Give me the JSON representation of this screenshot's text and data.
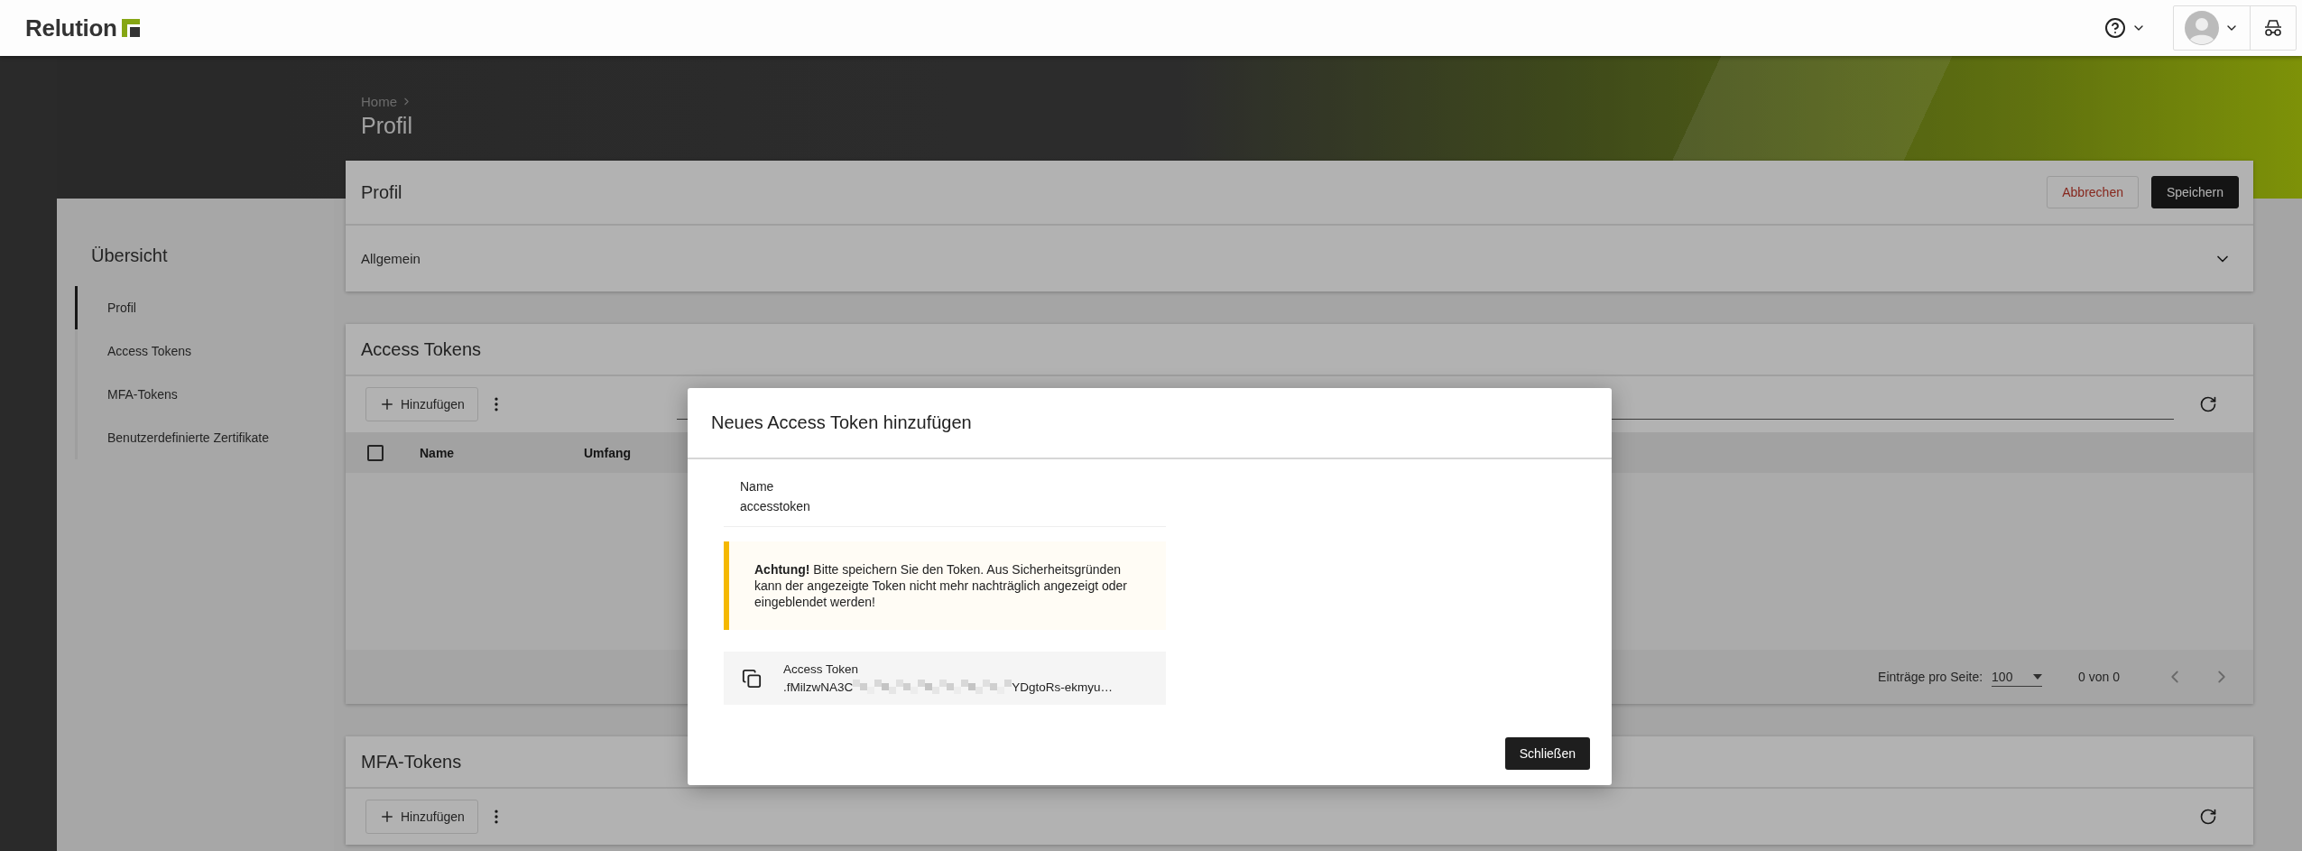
{
  "header": {
    "logo": "Relution"
  },
  "breadcrumb": {
    "items": [
      "Home"
    ],
    "title": "Profil"
  },
  "sidebar": {
    "title": "Übersicht",
    "items": [
      {
        "label": "Profil",
        "selected": true
      },
      {
        "label": "Access Tokens",
        "selected": false
      },
      {
        "label": "MFA-Tokens",
        "selected": false
      },
      {
        "label": "Benutzerdefinierte Zertifikate",
        "selected": false
      }
    ]
  },
  "profile_card": {
    "title": "Profil",
    "buttons": [
      {
        "label": "Abbrechen",
        "kind": "cancel"
      },
      {
        "label": "Speichern",
        "kind": "primary"
      }
    ],
    "section": {
      "label": "Allgemein",
      "expanded": false
    }
  },
  "access_tokens": {
    "title": "Access Tokens",
    "add_button": "Hinzufügen",
    "select_all": {
      "checked": false
    },
    "columns": [
      "Name",
      "Umfang"
    ],
    "rows_per_page_label": "Einträge pro Seite:",
    "rows_per_page": "100",
    "range": "0 von 0"
  },
  "mfa_tokens": {
    "title": "MFA-Tokens",
    "add_button": "Hinzufügen"
  },
  "dialog": {
    "title": "Neues Access Token hinzufügen",
    "name_label": "Name",
    "name_value": "accesstoken",
    "warning": "**Achtung!** Bitte speichern Sie den Token. Aus Sicherheitsgründen kann der angezeigte Token nicht mehr nachträglich angezeigt oder eingeblendet werden!",
    "token_label": "Access Token",
    "token_start": ".fMilzwNA3C",
    "token_end": "YDgtoRs-ekmyu…",
    "close_button": "Schließen"
  }
}
